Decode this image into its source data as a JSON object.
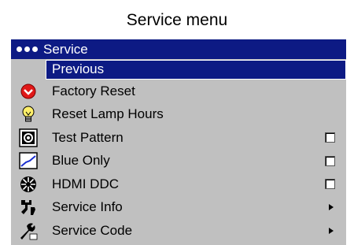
{
  "caption": "Service menu",
  "menu": {
    "title": "Service",
    "selected_item": "Previous",
    "items": [
      {
        "label": "Factory Reset",
        "icon": "factory-reset-icon",
        "control": "none"
      },
      {
        "label": "Reset Lamp Hours",
        "icon": "lamp-icon",
        "control": "none"
      },
      {
        "label": "Test Pattern",
        "icon": "test-pattern-icon",
        "control": "checkbox"
      },
      {
        "label": "Blue Only",
        "icon": "blue-only-icon",
        "control": "checkbox"
      },
      {
        "label": "HDMI DDC",
        "icon": "hdmi-ddc-icon",
        "control": "checkbox"
      },
      {
        "label": "Service Info",
        "icon": "service-info-icon",
        "control": "submenu"
      },
      {
        "label": "Service Code",
        "icon": "service-code-icon",
        "control": "submenu"
      }
    ]
  },
  "colors": {
    "menu_background": "#c0c0c0",
    "title_bar": "#0d1a84",
    "highlight": "#0d1a84",
    "factory_reset_red": "#e01818"
  }
}
